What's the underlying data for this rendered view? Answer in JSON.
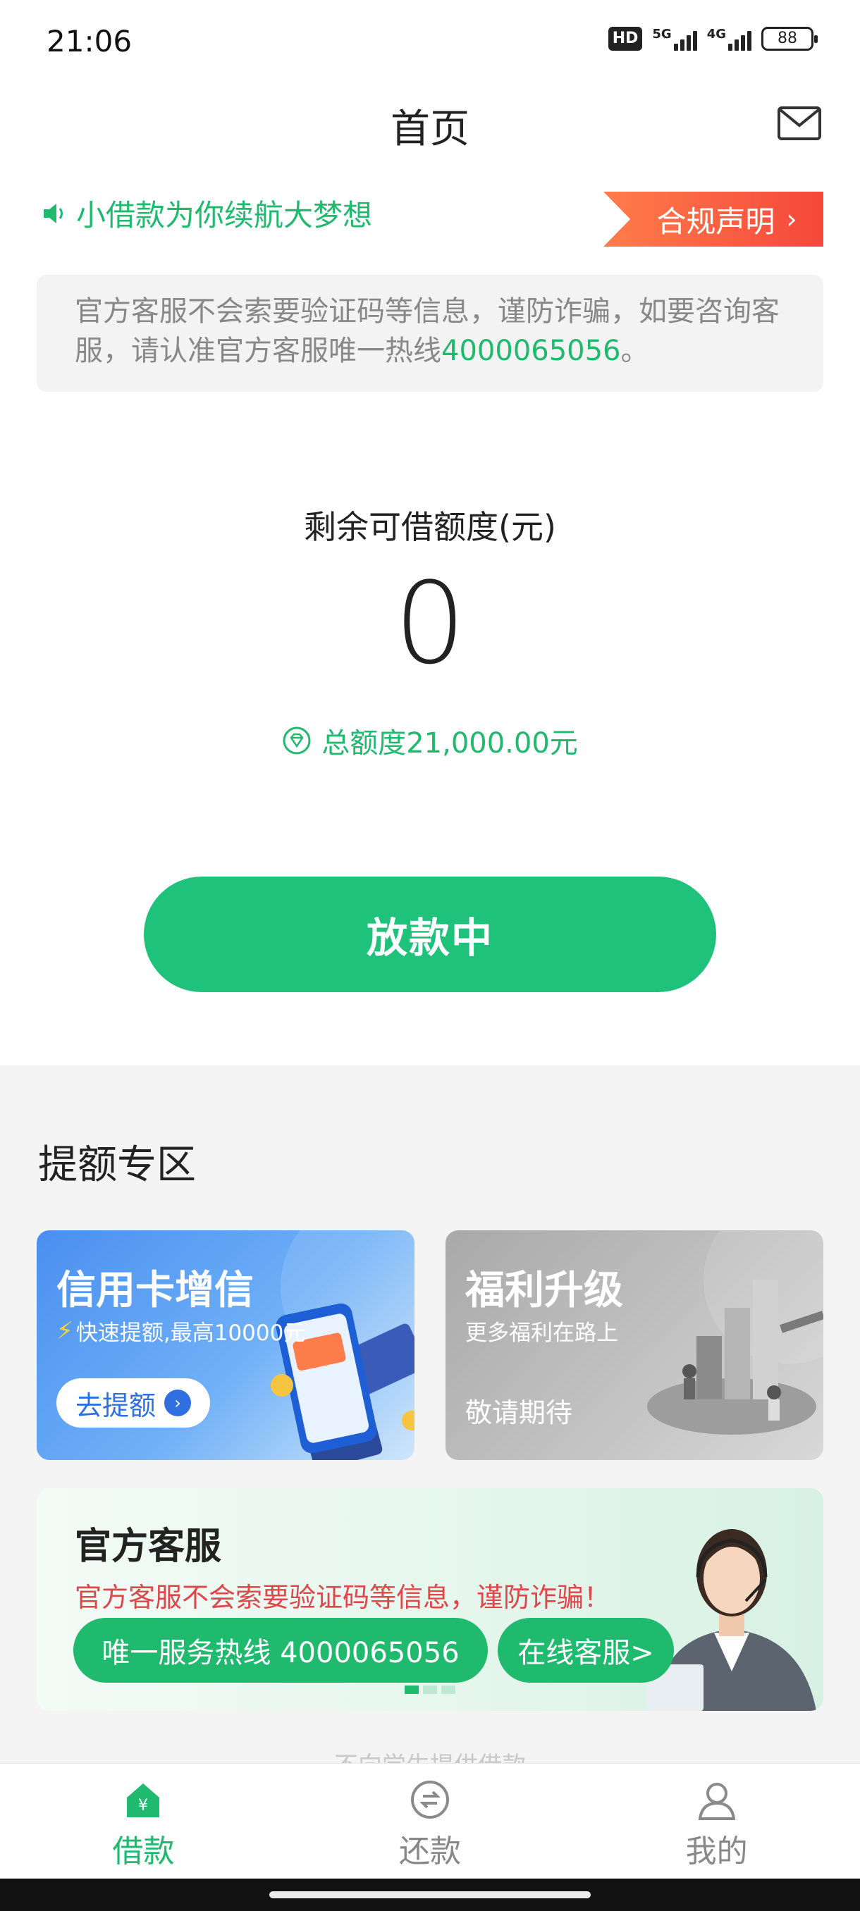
{
  "status_bar": {
    "time": "21:06",
    "hd_badge": "HD",
    "network_1": "5G",
    "network_2": "4G",
    "battery": "88"
  },
  "header": {
    "title": "首页",
    "mail_icon": "mail-icon"
  },
  "notice": {
    "text": "小借款为你续航大梦想",
    "compliance_label": "合规声明",
    "compliance_chevron": "›"
  },
  "warning": {
    "text_before": "官方客服不会索要验证码等信息，谨防诈骗，如要咨询客服，请认准官方客服唯一热线",
    "hotline": "4000065056",
    "text_after": "。"
  },
  "credit": {
    "label": "剩余可借额度(元)",
    "value": "0",
    "total": "总额度21,000.00元",
    "button_label": "放款中"
  },
  "boost_section": {
    "title": "提额专区",
    "credit_card": {
      "title": "信用卡增信",
      "subtitle": "快速提额,最高10000元",
      "button_label": "去提额"
    },
    "welfare": {
      "title": "福利升级",
      "subtitle": "更多福利在路上",
      "footer": "敬请期待"
    }
  },
  "service": {
    "title": "官方客服",
    "warning": "官方客服不会索要验证码等信息，谨防诈骗！",
    "hotline_label": "唯一服务热线 4000065056",
    "online_label": "在线客服>"
  },
  "footnote": "- 不向学生提供借款 -",
  "bottom_nav": {
    "items": [
      {
        "label": "借款",
        "icon": "home-loan-icon",
        "active": true
      },
      {
        "label": "还款",
        "icon": "repay-icon",
        "active": false
      },
      {
        "label": "我的",
        "icon": "user-icon",
        "active": false
      }
    ]
  },
  "colors": {
    "accent": "#1fba6e",
    "warning_red": "#e0474b",
    "compliance_orange": "#f5473b"
  }
}
